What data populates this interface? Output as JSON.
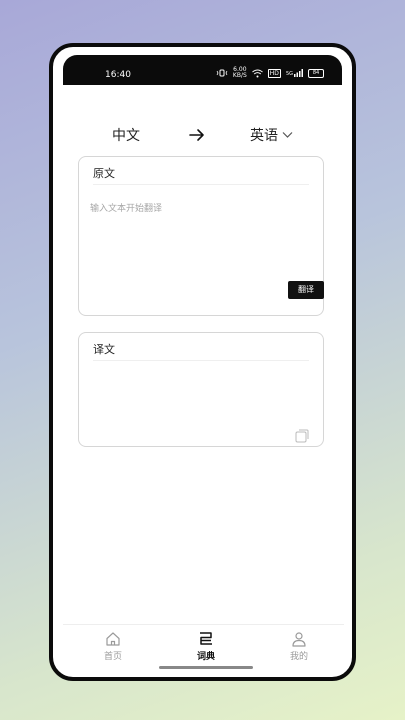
{
  "status_bar": {
    "time": "16:40",
    "net_speed_value": "6.00",
    "net_speed_unit": "KB/S",
    "hd_label": "HD",
    "signal_label": "5G",
    "battery_level": "84"
  },
  "language": {
    "source": "中文",
    "target": "英语"
  },
  "source_card": {
    "title": "原文",
    "placeholder": "输入文本开始翻译",
    "translate_button": "翻译"
  },
  "target_card": {
    "title": "译文"
  },
  "tabbar": {
    "items": [
      {
        "label": "首页",
        "icon": "home-icon"
      },
      {
        "label": "词典",
        "icon": "dictionary-icon",
        "active": true
      },
      {
        "label": "我的",
        "icon": "profile-icon"
      }
    ]
  },
  "colors": {
    "accent": "#111111",
    "inactive": "#9a9a9a"
  }
}
